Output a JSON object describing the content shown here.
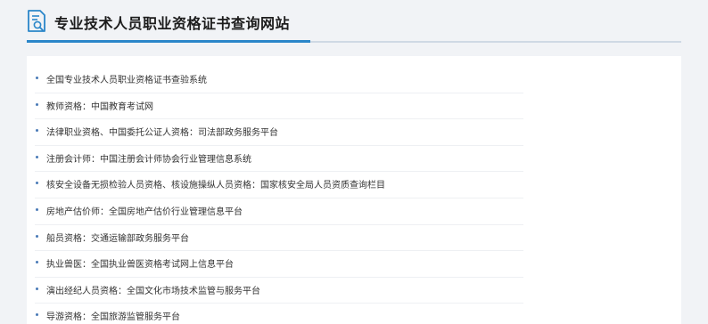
{
  "header": {
    "title": "专业技术人员职业资格证书查询网站",
    "logo_icon": "certificate-search-icon"
  },
  "colors": {
    "accent": "#2a86c9",
    "text": "#333333",
    "background": "#f1f3f6"
  },
  "links": [
    {
      "label": "全国专业技术人员职业资格证书查验系统"
    },
    {
      "label": "教师资格：中国教育考试网"
    },
    {
      "label": "法律职业资格、中国委托公证人资格：司法部政务服务平台"
    },
    {
      "label": "注册会计师：中国注册会计师协会行业管理信息系统"
    },
    {
      "label": "核安全设备无损检验人员资格、核设施操纵人员资格：国家核安全局人员资质查询栏目"
    },
    {
      "label": "房地产估价师：全国房地产估价行业管理信息平台"
    },
    {
      "label": "船员资格：交通运输部政务服务平台"
    },
    {
      "label": "执业兽医：全国执业兽医资格考试网上信息平台"
    },
    {
      "label": "演出经纪人员资格：全国文化市场技术监管与服务平台"
    },
    {
      "label": "导游资格：全国旅游监管服务平台"
    }
  ]
}
